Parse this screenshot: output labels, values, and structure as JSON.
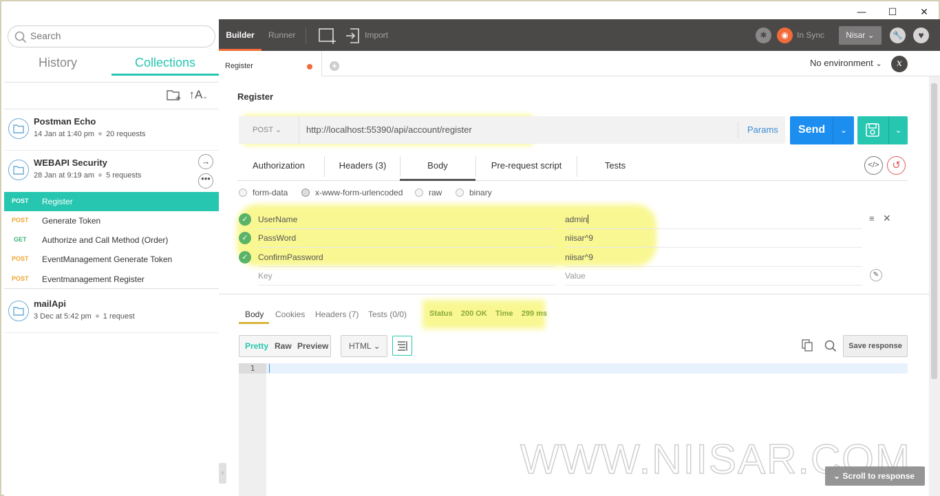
{
  "window": {
    "minimize": "—",
    "maximize": "☐",
    "close": "✕"
  },
  "sidebar": {
    "search_placeholder": "Search",
    "tabs": [
      "History",
      "Collections"
    ],
    "collections": [
      {
        "name": "Postman Echo",
        "date": "14 Jan at 1:40 pm",
        "count": "20 requests"
      },
      {
        "name": "WEBAPI Security",
        "date": "28 Jan at 9:19 am",
        "count": "5 requests"
      },
      {
        "name": "mailApi",
        "date": "3 Dec at 5:42 pm",
        "count": "1 request"
      }
    ],
    "requests": [
      {
        "method": "POST",
        "name": "Register"
      },
      {
        "method": "POST",
        "name": "Generate Token"
      },
      {
        "method": "GET",
        "name": "Authorize and Call Method (Order)"
      },
      {
        "method": "POST",
        "name": "EventManagement Generate Token"
      },
      {
        "method": "POST",
        "name": "Eventmanagement Register"
      }
    ]
  },
  "topbar": {
    "builder": "Builder",
    "runner": "Runner",
    "import": "Import",
    "sync": "In Sync",
    "user": "Nisar"
  },
  "tabs": {
    "current": "Register",
    "environment": "No environment"
  },
  "request": {
    "title": "Register",
    "method": "POST",
    "url": "http://localhost:55390/api/account/register",
    "params": "Params",
    "send": "Send",
    "subtabs": [
      "Authorization",
      "Headers (3)",
      "Body",
      "Pre-request script",
      "Tests"
    ],
    "body_modes": [
      "form-data",
      "x-www-form-urlencoded",
      "raw",
      "binary"
    ],
    "selected_mode": "x-www-form-urlencoded",
    "fields": [
      {
        "key": "UserName",
        "value": "admin"
      },
      {
        "key": "PassWord",
        "value": "niisar^9"
      },
      {
        "key": "ConfirmPassword",
        "value": "niisar^9"
      }
    ],
    "key_placeholder": "Key",
    "value_placeholder": "Value"
  },
  "response": {
    "tabs": [
      "Body",
      "Cookies",
      "Headers (7)",
      "Tests (0/0)"
    ],
    "status_label": "Status",
    "status": "200 OK",
    "time_label": "Time",
    "time": "299 ms",
    "formats": [
      "Pretty",
      "Raw",
      "Preview"
    ],
    "language": "HTML",
    "save": "Save response",
    "line1": "1",
    "scroll": "Scroll to response"
  },
  "watermark": "WWW.NIISAR.COM",
  "colors": {
    "accent": "#26c6b0",
    "send": "#1c8ef0",
    "topbar": "#4b4848",
    "post": "#f0a430",
    "get": "#3cb27a",
    "highlight": "#f7f56e"
  }
}
